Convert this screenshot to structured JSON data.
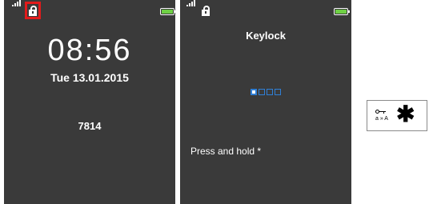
{
  "lock_screen": {
    "time": "08:56",
    "date": "Tue 13.01.2015",
    "code": "7814",
    "icons": [
      "signal-icon",
      "lock-icon",
      "battery-icon"
    ],
    "highlight_color": "#e21b1b",
    "battery_color": "#6fd045"
  },
  "keylock_screen": {
    "title": "Keylock",
    "pin_digits_total": 4,
    "pin_digits_entered": 1,
    "instruction": "Press and hold *",
    "icons": [
      "signal-icon",
      "lock-icon",
      "battery-icon"
    ],
    "accent_color": "#2f7fd6"
  },
  "key_legend": {
    "icon": "key-icon",
    "key_label": "a » A",
    "symbol": "✱"
  }
}
